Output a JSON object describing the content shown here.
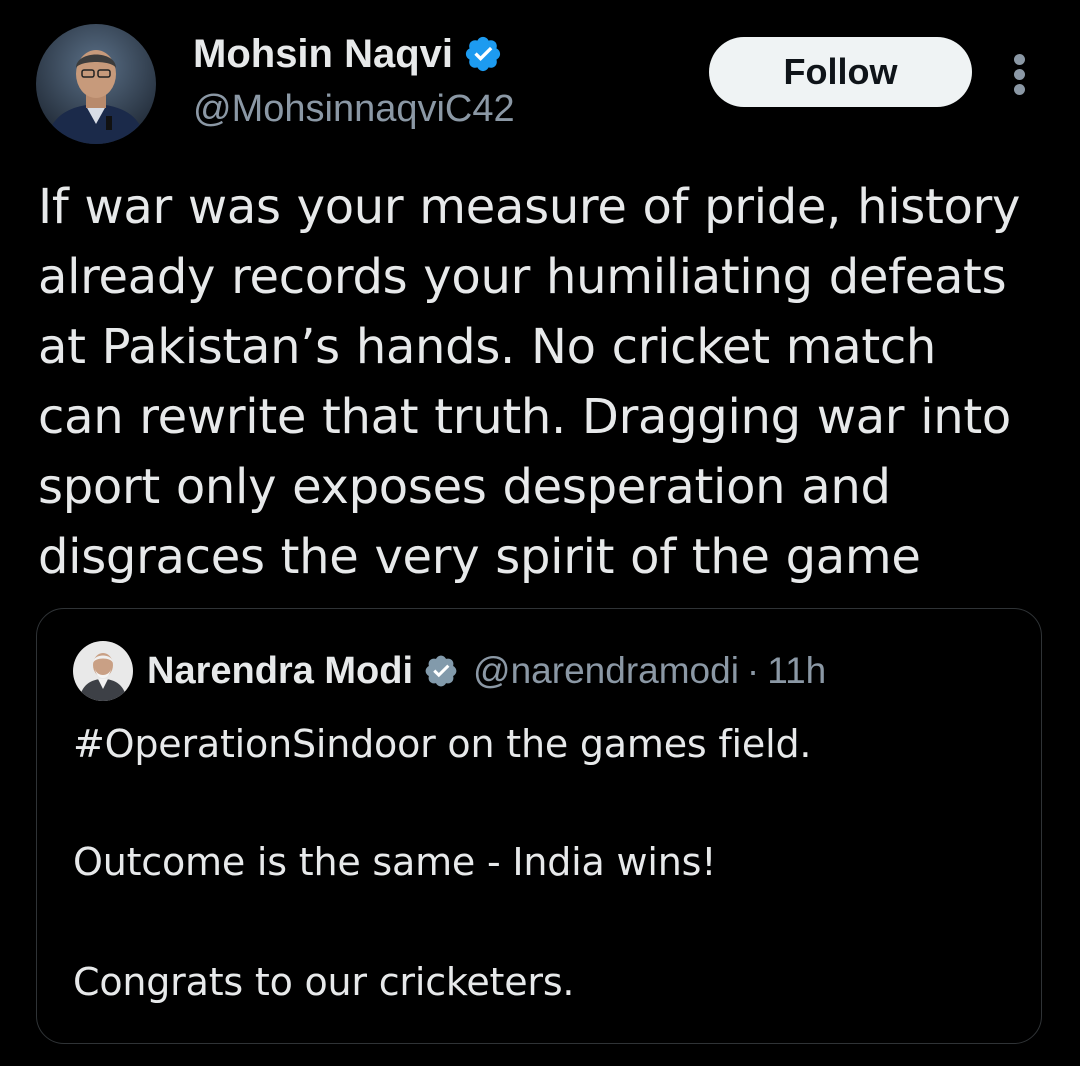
{
  "author": {
    "name": "Mohsin Naqvi",
    "handle": "@MohsinnaqviC42",
    "avatar_icon": "profile-photo",
    "verified_icon": "verified-badge-icon"
  },
  "actions": {
    "follow_label": "Follow",
    "more_icon": "more-vertical-icon"
  },
  "tweet": {
    "lines": [
      "If war was your measure of pride, history",
      "already records your humiliating defeats",
      "at Pakistan’s hands. No cricket match",
      "can rewrite that truth. Dragging war into",
      "sport only exposes desperation and",
      "disgraces the very spirit of the game"
    ]
  },
  "quote": {
    "name": "Narendra Modi",
    "handle": "@narendramodi",
    "separator": "·",
    "time": "11h",
    "paragraphs": [
      "#OperationSindoor on the games field.",
      "Outcome is the same - India wins!",
      "Congrats to our cricketers."
    ]
  },
  "colors": {
    "background": "#000000",
    "text": "#e7e9ea",
    "secondary_text": "#8b98a5",
    "verified_blue": "#1d9bf0",
    "verified_gray": "#829aab",
    "follow_bg": "#eff3f4",
    "border": "#2f3336"
  }
}
